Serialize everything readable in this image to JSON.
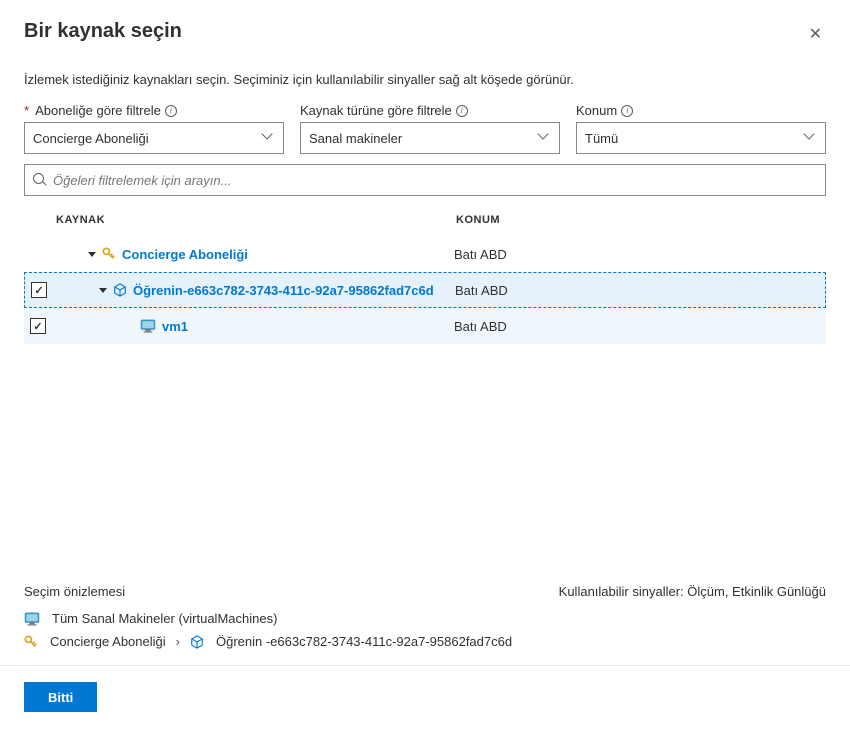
{
  "header": {
    "title": "Bir kaynak seçin"
  },
  "description": "İzlemek istediğiniz kaynakları seçin. Seçiminiz için kullanılabilir sinyaller sağ alt köşede görünür.",
  "filters": {
    "subscription": {
      "label": "Aboneliğe göre filtrele",
      "value": "Concierge Aboneliği"
    },
    "resourceType": {
      "label": "Kaynak türüne göre filtrele",
      "value": "Sanal makineler"
    },
    "location": {
      "label": "Konum",
      "value": "Tümü"
    }
  },
  "search": {
    "placeholder": "Öğeleri filtrelemek için arayın..."
  },
  "table": {
    "headers": {
      "resource": "KAYNAK",
      "location": "KONUM"
    },
    "rows": [
      {
        "name": "Concierge Aboneliği",
        "location": "Batı ABD"
      },
      {
        "name": "Öğrenin-e663c782-3743-411c-92a7-95862fad7c6d",
        "location": "Batı ABD"
      },
      {
        "name": "vm1",
        "location": "Batı ABD"
      }
    ]
  },
  "footer": {
    "previewLabel": "Seçim önizlemesi",
    "signalsLabel": "Kullanılabilir sinyaller: Ölçüm, Etkinlik Günlüğü",
    "allVms": "Tüm Sanal Makineler (virtualMachines)",
    "subscription": "Concierge Aboneliği",
    "resourceGroup": "Öğrenin -e663c782-3743-411c-92a7-95862fad7c6d",
    "doneButton": "Bitti"
  }
}
